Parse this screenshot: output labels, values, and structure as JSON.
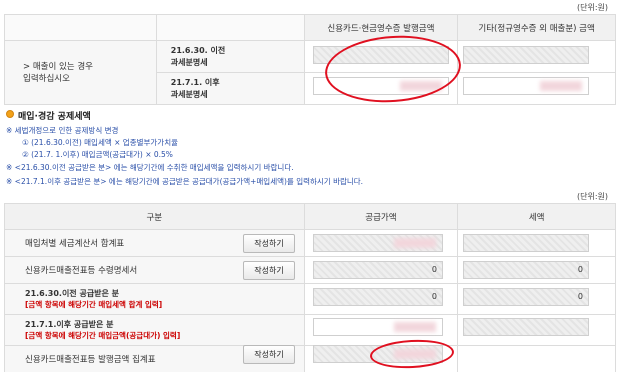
{
  "top": {
    "unit_label": "(단위:원)",
    "headers": {
      "card_receipt": "신용카드·현금영수증 발행금액",
      "other": "기타(정규영수증 외 매출분) 금액"
    },
    "row_label": "> 매출이 있는 경우\n입력하십시오",
    "period1": "21.6.30. 이전\n과세분명세",
    "period2": "21.7.1. 이후\n과세분명세"
  },
  "section": {
    "title": "매입·경감 공제세액",
    "notes": [
      "※ 세법개정으로 인한 공제방식 변경",
      "① (21.6.30.이전) 매입세액 × 업종별부가가치율",
      "② (21.7. 1.이후) 매입금액(공급대가) × 0.5%",
      "※ <21.6.30.이전 공급받은 분> 에는 해당기간에 수취한 매입세액을 입력하시기 바랍니다.",
      "※ <21.7.1.이후 공급받은 분> 에는 해당기간에 공급받은 공급대가(공급가액+매입세액)를 입력하시기 바랍니다."
    ]
  },
  "bottom": {
    "unit_label": "(단위:원)",
    "headers": {
      "division": "구분",
      "supply": "공급가액",
      "tax": "세액"
    },
    "rows": [
      {
        "label": "매입처별 세금계산서 합계표",
        "button": "작성하기"
      },
      {
        "label": "신용카드매출전표등 수령명세서",
        "button": "작성하기",
        "supply_value": "0",
        "tax_value": "0"
      },
      {
        "label": "21.6.30.이전 공급받은 분",
        "sub": "[금액 항목에 해당기간 매입세액 합계 입력]",
        "supply_value": "0",
        "tax_value": "0"
      },
      {
        "label": "21.7.1.이후 공급받은 분",
        "sub": "[금액 항목에 해당기간 매입금액(공급대가) 입력]"
      },
      {
        "label": "신용카드매출전표등 발행금액 집계표",
        "button": "작성하기"
      }
    ]
  },
  "colors": {
    "annotation": "#e01020",
    "alert_text": "#cc0000",
    "note_text": "#2a4fa8"
  }
}
